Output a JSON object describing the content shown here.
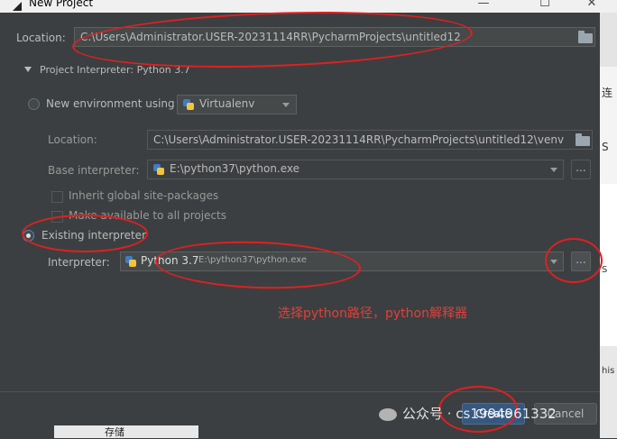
{
  "window": {
    "title": "New Project"
  },
  "location": {
    "label": "Location:",
    "value": "C:\\Users\\Administrator.USER-20231114RR\\PycharmProjects\\untitled12"
  },
  "interpreter_section": {
    "label": "Project Interpreter: Python 3.7"
  },
  "new_env": {
    "radio_label": "New environment using",
    "tool": "Virtualenv",
    "location_label": "Location:",
    "location_value": "C:\\Users\\Administrator.USER-20231114RR\\PycharmProjects\\untitled12\\venv",
    "base_label": "Base interpreter:",
    "base_value": "E:\\python37\\python.exe",
    "inherit_label": "Inherit global site-packages",
    "available_label": "Make available to all projects"
  },
  "existing": {
    "radio_label": "Existing interpreter",
    "interp_label": "Interpreter:",
    "interp_name": "Python 3.7",
    "interp_path": "E:\\python37\\python.exe",
    "dots": "..."
  },
  "annotation": "选择python路径，python解释器",
  "buttons": {
    "create": "Create",
    "cancel": "Cancel"
  },
  "watermark": "公众号 · cs1994961332",
  "background_window": {
    "chars": [
      "连",
      "S",
      "S",
      "his"
    ],
    "bottom_text": "存储"
  },
  "colors": {
    "accent": "#365880",
    "annotation": "#e02020"
  }
}
